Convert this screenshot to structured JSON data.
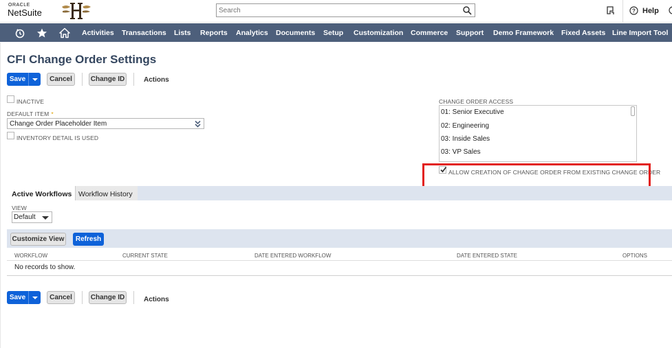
{
  "header": {
    "logo_oracle": "ORACLE",
    "logo_netsuite": "NetSuite",
    "search_placeholder": "Search",
    "help_label": "Help"
  },
  "nav": {
    "icons": [
      "recent-records-icon",
      "star-icon",
      "home-icon"
    ],
    "items": [
      {
        "label": "Activities"
      },
      {
        "label": "Transactions"
      },
      {
        "label": "Lists"
      },
      {
        "label": "Reports"
      },
      {
        "label": "Analytics"
      },
      {
        "label": "Documents"
      },
      {
        "label": "Setup"
      },
      {
        "label": "Customization"
      },
      {
        "label": "Commerce"
      },
      {
        "label": "Support"
      },
      {
        "label": "Demo Framework"
      },
      {
        "label": "Fixed Assets"
      },
      {
        "label": "Line Import Tool"
      }
    ],
    "background": "#4d5f7b"
  },
  "page": {
    "title": "CFI Change Order Settings"
  },
  "toolbar": {
    "save_label": "Save",
    "cancel_label": "Cancel",
    "change_id_label": "Change ID",
    "actions_label": "Actions"
  },
  "form": {
    "inactive_label": "INACTIVE",
    "inactive_checked": false,
    "default_item_label": "DEFAULT ITEM",
    "default_item_value": "Change Order Placeholder Item",
    "inventory_detail_label": "INVENTORY DETAIL IS USED",
    "inventory_detail_checked": false,
    "change_order_access_label": "CHANGE ORDER ACCESS",
    "change_order_access_options": [
      "01: Senior Executive",
      "02: Engineering",
      "03: Inside Sales",
      "03: VP Sales"
    ],
    "allow_creation_label": "ALLOW CREATION OF CHANGE ORDER FROM EXISTING CHANGE ORDER",
    "allow_creation_checked": true
  },
  "workflow": {
    "tabs": [
      {
        "label": "Active Workflows",
        "active": true
      },
      {
        "label": "Workflow History",
        "active": false
      }
    ],
    "view_label": "VIEW",
    "view_value": "Default",
    "customize_view_label": "Customize View",
    "refresh_label": "Refresh",
    "columns": [
      "WORKFLOW",
      "CURRENT STATE",
      "DATE ENTERED WORKFLOW",
      "DATE ENTERED STATE",
      "OPTIONS"
    ],
    "empty_message": "No records to show."
  },
  "colors": {
    "primary_button": "#0e62d9",
    "title": "#34465f",
    "highlight": "#e21f1b"
  }
}
